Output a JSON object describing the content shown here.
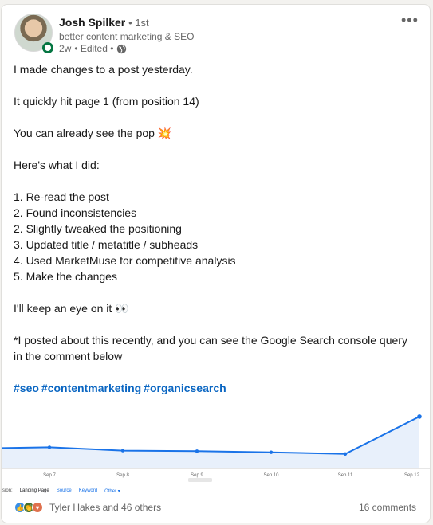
{
  "author": {
    "name": "Josh Spilker",
    "degree": "• 1st",
    "headline": "better content marketing & SEO",
    "time": "2w",
    "edited": "• Edited •"
  },
  "icons": {
    "more": "more-icon",
    "globe": "globe-icon"
  },
  "post": {
    "lines": [
      "I made changes to a post yesterday.",
      "",
      "It quickly hit page 1 (from position 14)",
      "",
      "You can already see the pop 💥",
      "",
      "Here's what I did:",
      "",
      "1. Re-read the post",
      "2. Found inconsistencies",
      "2. Slightly tweaked the positioning",
      "3. Updated title / metatitle / subheads",
      "4. Used MarketMuse for competitive analysis",
      "5. Make the changes",
      "",
      "I'll keep an eye on it 👀",
      "",
      "*I posted about this recently, and you can see the Google Search console query in the comment below",
      ""
    ],
    "hashtags": [
      "#seo",
      "#contentmarketing",
      "#organicsearch"
    ]
  },
  "chart_data": {
    "type": "area",
    "categories": [
      "Sep 7",
      "Sep 8",
      "Sep 9",
      "Sep 10",
      "Sep 11",
      "Sep 12"
    ],
    "values": [
      3.8,
      3.2,
      3.1,
      2.9,
      2.6,
      9.3
    ],
    "ylim": [
      0,
      10
    ],
    "color": "#1a73e8",
    "grid": false
  },
  "chart_footer": {
    "dimension_label": "sion:",
    "landing_page": "Landing Page",
    "source": "Source",
    "keyword": "Keyword",
    "other": "Other ▾"
  },
  "reactions": {
    "names": "Tyler Hakes and 46 others",
    "comments": "16 comments",
    "colors": {
      "like": "#378fe9",
      "celebrate": "#44712e",
      "love": "#df704d"
    }
  }
}
